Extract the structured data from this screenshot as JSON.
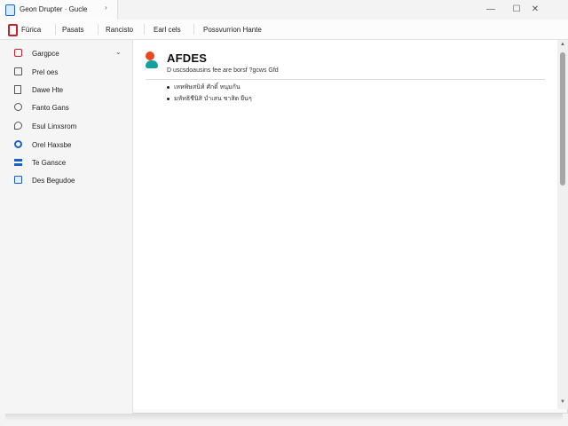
{
  "window": {
    "tab_title": "Geon Drupter  · Gucle",
    "tab_close": "›",
    "minimize": "—",
    "maximize": "☐",
    "close": "✕"
  },
  "toolbar": {
    "items": [
      "Fürica",
      "Pasats",
      "Rancisto",
      "Earl cels",
      "Possvurrion Hante"
    ]
  },
  "sidebar": {
    "items": [
      {
        "label": "Gargpce",
        "icon": "bookmark-icon",
        "color": "#c4232b"
      },
      {
        "label": "Prel oes",
        "icon": "calendar-icon",
        "color": "#555555"
      },
      {
        "label": "Dawe Hte",
        "icon": "document-icon",
        "color": "#555555"
      },
      {
        "label": "Fanto Gans",
        "icon": "circle-info-icon",
        "color": "#555555"
      },
      {
        "label": "Esul Linxsrom",
        "icon": "chat-icon",
        "color": "#555555"
      },
      {
        "label": "Orel Haxsbe",
        "icon": "globe-icon",
        "color": "#1a5fc8"
      },
      {
        "label": "Te Gansce",
        "icon": "stack-icon",
        "color": "#1a5fc8"
      },
      {
        "label": "Des Begudoe",
        "icon": "image-icon",
        "color": "#1a5fc8"
      }
    ],
    "first_chevron": "⌄"
  },
  "main": {
    "title": "AFDES",
    "subtitle": "D uscsdoausins fee are borsf ?gcws Gfd",
    "bullets": [
      "เหหพิษสนิท้ ศักดิ์ หนุมกัน",
      "มหัทธิชีนิสิ บำเสน ชาสิด ยืนๆ"
    ]
  },
  "colors": {
    "accent": "#1a66c8",
    "logo_top": "#e8491c",
    "logo_bottom": "#15a0a0"
  }
}
